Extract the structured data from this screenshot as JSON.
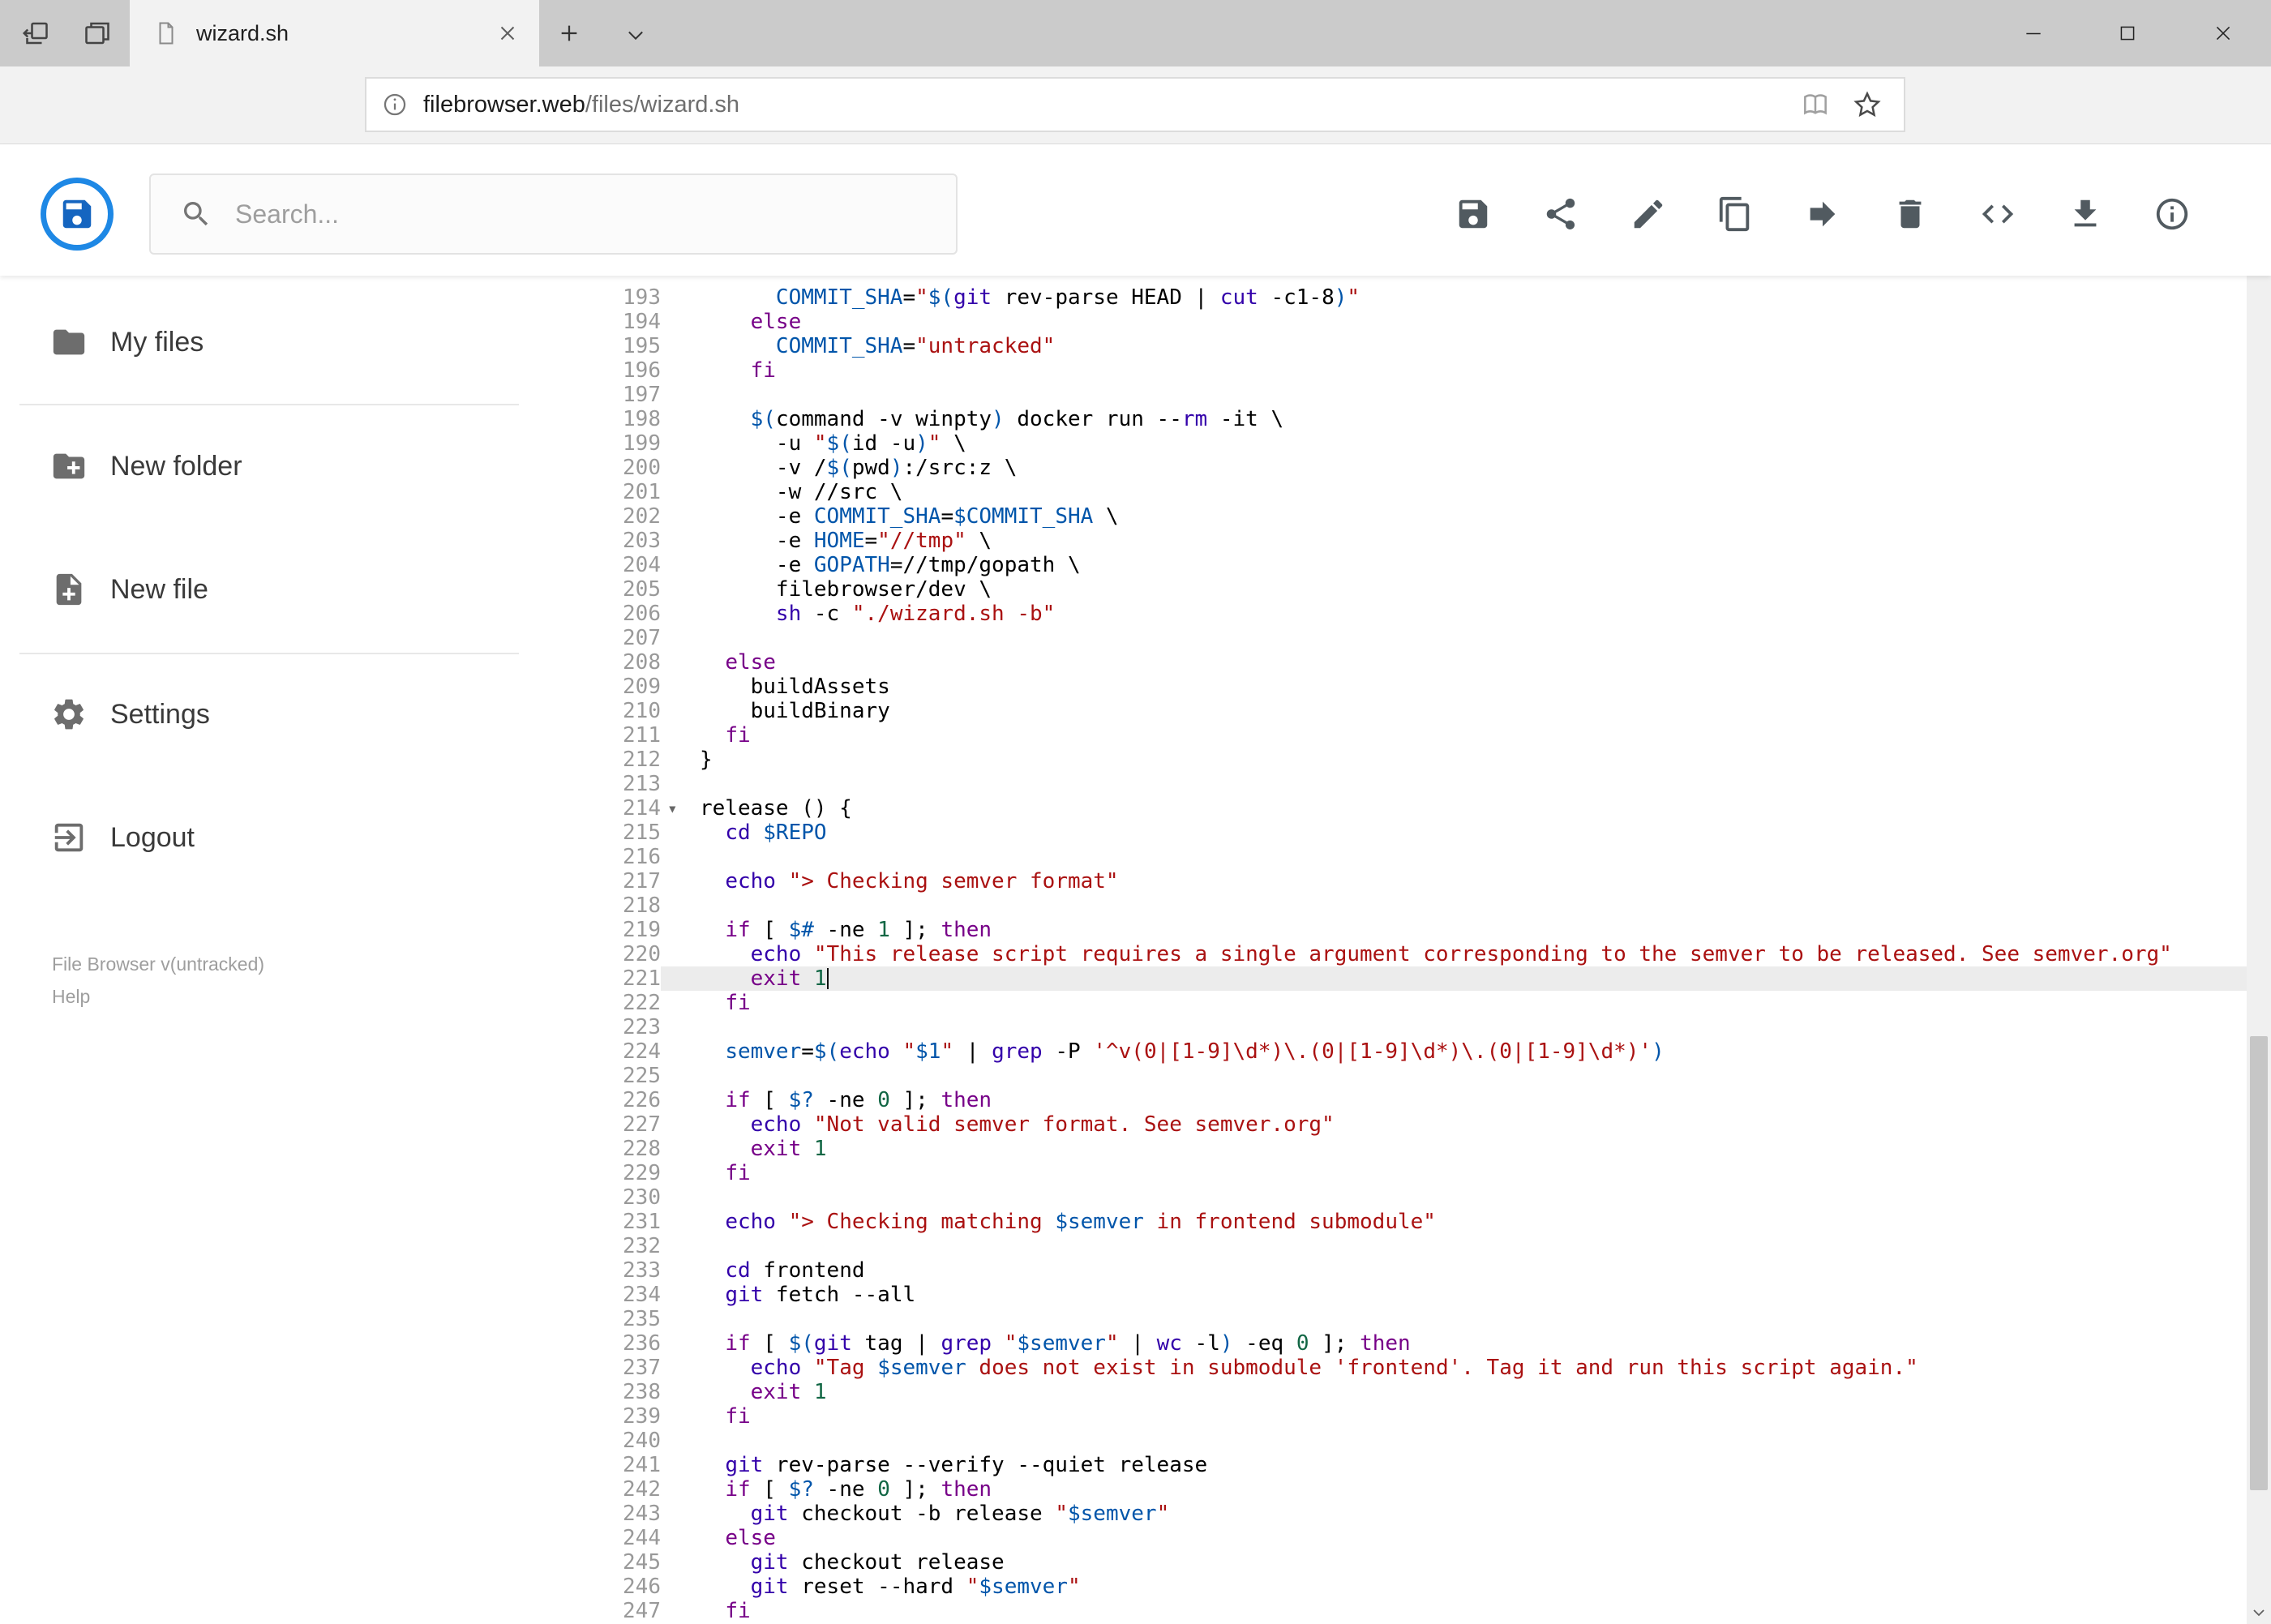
{
  "browser": {
    "tab_title": "wizard.sh",
    "url_domain": "filebrowser.web",
    "url_path": "/files/wizard.sh"
  },
  "header": {
    "search_placeholder": "Search...",
    "toolbar_icons": [
      "save",
      "share",
      "rename",
      "copy",
      "move",
      "delete",
      "raw",
      "download",
      "info"
    ]
  },
  "sidebar": {
    "items": [
      {
        "label": "My files",
        "icon": "folder"
      },
      {
        "label": "New folder",
        "icon": "create-new-folder"
      },
      {
        "label": "New file",
        "icon": "new-file"
      },
      {
        "label": "Settings",
        "icon": "settings-gear"
      },
      {
        "label": "Logout",
        "icon": "logout"
      }
    ],
    "footer_version": "File Browser v(untracked)",
    "footer_help": "Help"
  },
  "colors": {
    "logo_blue": "#1e88e5",
    "logo_dark_blue": "#1565c0",
    "active_line_bg": "#ececec",
    "syntax": {
      "keyword": "#770088",
      "string": "#aa1111",
      "builtin": "#3300aa",
      "variable": "#0055aa",
      "number": "#116644",
      "text": "#000000",
      "line_number": "#999999"
    }
  },
  "editor": {
    "language": "shell",
    "first_line": 193,
    "active_line": 221,
    "cursor_col": 10,
    "fold_markers": [
      214
    ],
    "lines": [
      "      COMMIT_SHA=\"$(git rev-parse HEAD | cut -c1-8)\"",
      "    else",
      "      COMMIT_SHA=\"untracked\"",
      "    fi",
      "",
      "    $(command -v winpty) docker run --rm -it \\",
      "      -u \"$(id -u)\" \\",
      "      -v /$(pwd):/src:z \\",
      "      -w //src \\",
      "      -e COMMIT_SHA=$COMMIT_SHA \\",
      "      -e HOME=\"//tmp\" \\",
      "      -e GOPATH=//tmp/gopath \\",
      "      filebrowser/dev \\",
      "      sh -c \"./wizard.sh -b\"",
      "",
      "  else",
      "    buildAssets",
      "    buildBinary",
      "  fi",
      "}",
      "",
      "release () {",
      "  cd $REPO",
      "",
      "  echo \"> Checking semver format\"",
      "",
      "  if [ $# -ne 1 ]; then",
      "    echo \"This release script requires a single argument corresponding to the semver to be released. See semver.org\"",
      "    exit 1",
      "  fi",
      "",
      "  semver=$(echo \"$1\" | grep -P '^v(0|[1-9]\\d*)\\.(0|[1-9]\\d*)\\.(0|[1-9]\\d*)')",
      "",
      "  if [ $? -ne 0 ]; then",
      "    echo \"Not valid semver format. See semver.org\"",
      "    exit 1",
      "  fi",
      "",
      "  echo \"> Checking matching $semver in frontend submodule\"",
      "",
      "  cd frontend",
      "  git fetch --all",
      "",
      "  if [ $(git tag | grep \"$semver\" | wc -l) -eq 0 ]; then",
      "    echo \"Tag $semver does not exist in submodule 'frontend'. Tag it and run this script again.\"",
      "    exit 1",
      "  fi",
      "",
      "  git rev-parse --verify --quiet release",
      "  if [ $? -ne 0 ]; then",
      "    git checkout -b release \"$semver\"",
      "  else",
      "    git checkout release",
      "    git reset --hard \"$semver\"",
      "  fi"
    ]
  }
}
